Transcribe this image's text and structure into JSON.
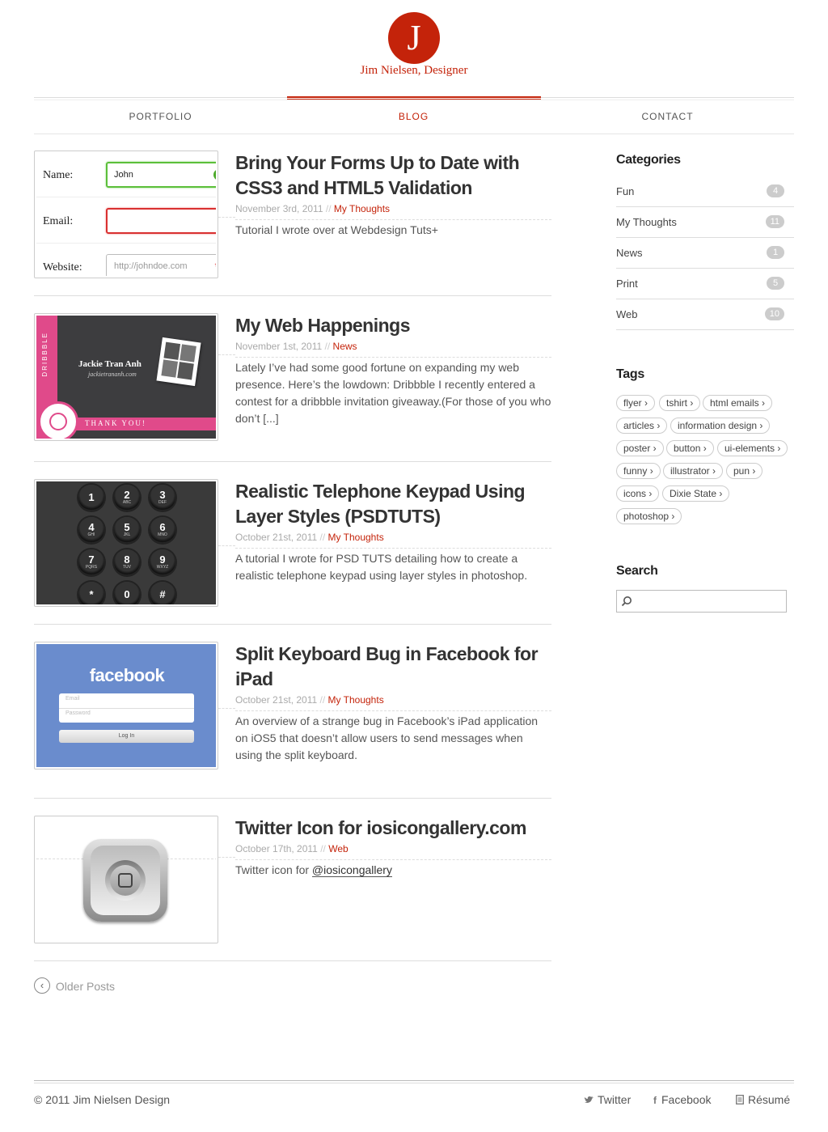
{
  "header": {
    "logo_letter": "J",
    "site_name": "Jim Nielsen, Designer"
  },
  "nav": [
    {
      "label": "PORTFOLIO"
    },
    {
      "label": "BLOG"
    },
    {
      "label": "CONTACT"
    }
  ],
  "posts": [
    {
      "title_lines": [
        "Bring Your Forms Up to Date with",
        "CSS3 and HTML5 Validation"
      ],
      "date": "November 3rd, 2011",
      "sep": "//",
      "category": "My Thoughts",
      "excerpt_lines": [
        "Tutorial I wrote over at Webdesign Tuts+"
      ]
    },
    {
      "title_lines": [
        "My Web Happenings"
      ],
      "date": "November 1st, 2011",
      "sep": "//",
      "category": "News",
      "excerpt_lines": [
        "Lately I’ve had some good fortune on expanding my web",
        "presence. Here’s the lowdown: Dribbble I recently entered a",
        "contest for a dribbble invitation giveaway.(For those of you who",
        "don’t [...]"
      ]
    },
    {
      "title_lines": [
        "Realistic Telephone Keypad Using",
        "Layer Styles (PSDTUTS)"
      ],
      "date": "October 21st, 2011",
      "sep": "//",
      "category": "My Thoughts",
      "excerpt_lines": [
        "A tutorial I wrote for PSD TUTS detailing how to create a",
        "realistic telephone keypad using layer styles in photoshop."
      ]
    },
    {
      "title_lines": [
        "Split Keyboard Bug in Facebook for",
        "iPad"
      ],
      "date": "October 21st, 2011",
      "sep": "//",
      "category": "My Thoughts",
      "excerpt_lines": [
        "An overview of a strange bug in Facebook’s iPad application",
        "on iOS5 that doesn’t allow users to send messages when",
        "using the split keyboard."
      ]
    },
    {
      "title_lines": [
        "Twitter Icon for iosicongallery.com"
      ],
      "date": "October 17th, 2011",
      "sep": "//",
      "category": "Web",
      "excerpt_prefix": "Twitter icon for",
      "excerpt_link": "@iosicongallery"
    }
  ],
  "thumb_forms": {
    "labels": [
      "Name:",
      "Email:",
      "Website:"
    ],
    "name_value": "John",
    "website_placeholder": "http://johndoe.com",
    "required_mark": "*"
  },
  "thumb_dribbble": {
    "side_text": "DRIBBBLE",
    "name": "Jackie Tran Anh",
    "url": "jackietrananh.com",
    "thanks": "THANK YOU!"
  },
  "thumb_keypad": {
    "keys": [
      [
        "1",
        ""
      ],
      [
        "2",
        "ABC"
      ],
      [
        "3",
        "DEF"
      ],
      [
        "4",
        "GHI"
      ],
      [
        "5",
        "JKL"
      ],
      [
        "6",
        "MNO"
      ],
      [
        "7",
        "PQRS"
      ],
      [
        "8",
        "TUV"
      ],
      [
        "9",
        "WXYZ"
      ],
      [
        "*",
        ""
      ],
      [
        "0",
        ""
      ],
      [
        "#",
        ""
      ]
    ]
  },
  "thumb_facebook": {
    "brand": "facebook",
    "email_placeholder": "Email",
    "password_placeholder": "Password",
    "button": "Log In"
  },
  "pagination": {
    "older": "Older Posts"
  },
  "sidebar": {
    "categories_title": "Categories",
    "categories": [
      {
        "name": "Fun",
        "count": "4"
      },
      {
        "name": "My Thoughts",
        "count": "11"
      },
      {
        "name": "News",
        "count": "1"
      },
      {
        "name": "Print",
        "count": "5"
      },
      {
        "name": "Web",
        "count": "10"
      }
    ],
    "tags_title": "Tags",
    "tags": [
      "flyer ›",
      "tshirt ›",
      "html emails ›",
      "articles ›",
      "information design ›",
      "poster ›",
      "button ›",
      "ui-elements ›",
      "funny ›",
      "illustrator ›",
      "pun ›",
      "icons ›",
      "Dixie State ›",
      "photoshop ›"
    ],
    "search_title": "Search",
    "search_placeholder": ""
  },
  "footer": {
    "copyright": "© 2011 Jim Nielsen Design",
    "links": [
      {
        "label": "Twitter",
        "icon": "twitter-bird-icon"
      },
      {
        "label": "Facebook",
        "icon": "facebook-f-icon"
      },
      {
        "label": "Résumé",
        "icon": "document-icon"
      }
    ]
  },
  "colors": {
    "accent": "#c4230a",
    "tag_count_bg": "#cccccc",
    "facebook_blue": "#6a8ccd"
  }
}
